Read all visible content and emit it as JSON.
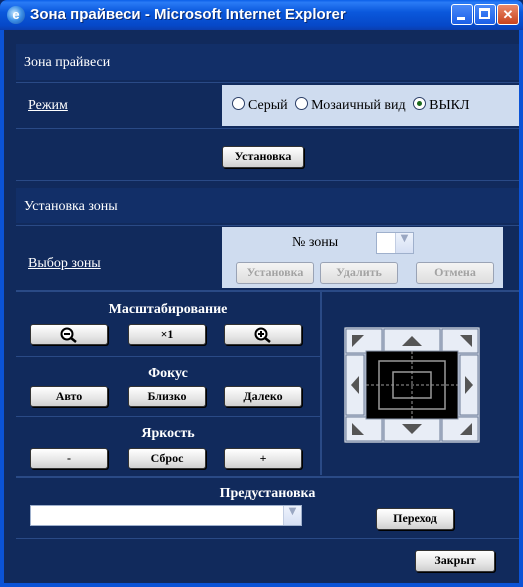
{
  "window": {
    "title": "Зона прайвеси - Microsoft Internet Explorer"
  },
  "privacy": {
    "section_title": "Зона прайвеси",
    "mode_label": "Режим",
    "mode_options": [
      {
        "label": "Серый",
        "selected": false
      },
      {
        "label": "Мозаичный вид",
        "selected": false
      },
      {
        "label": "ВЫКЛ",
        "selected": true
      }
    ],
    "set_button": "Установка"
  },
  "zone_setup": {
    "section_title": "Установка зоны",
    "zone_select_label": "Выбор зоны",
    "zone_number_label": "№ зоны",
    "zone_number_value": "",
    "buttons": {
      "set": "Установка",
      "delete": "Удалить",
      "cancel": "Отмена"
    }
  },
  "zoom": {
    "title": "Масштабирование",
    "out": "−",
    "x1": "×1",
    "in": "+"
  },
  "focus": {
    "title": "Фокус",
    "auto": "Авто",
    "near": "Близко",
    "far": "Далеко"
  },
  "brightness": {
    "title": "Яркость",
    "minus": "-",
    "reset": "Сброс",
    "plus": "+"
  },
  "preset": {
    "title": "Предустановка",
    "value": "",
    "go_button": "Переход"
  },
  "close_button": "Закрыт",
  "colors": {
    "titlebar": "#0a58dc",
    "client_bg": "#112a5c",
    "light_panel": "#cfdcef"
  }
}
